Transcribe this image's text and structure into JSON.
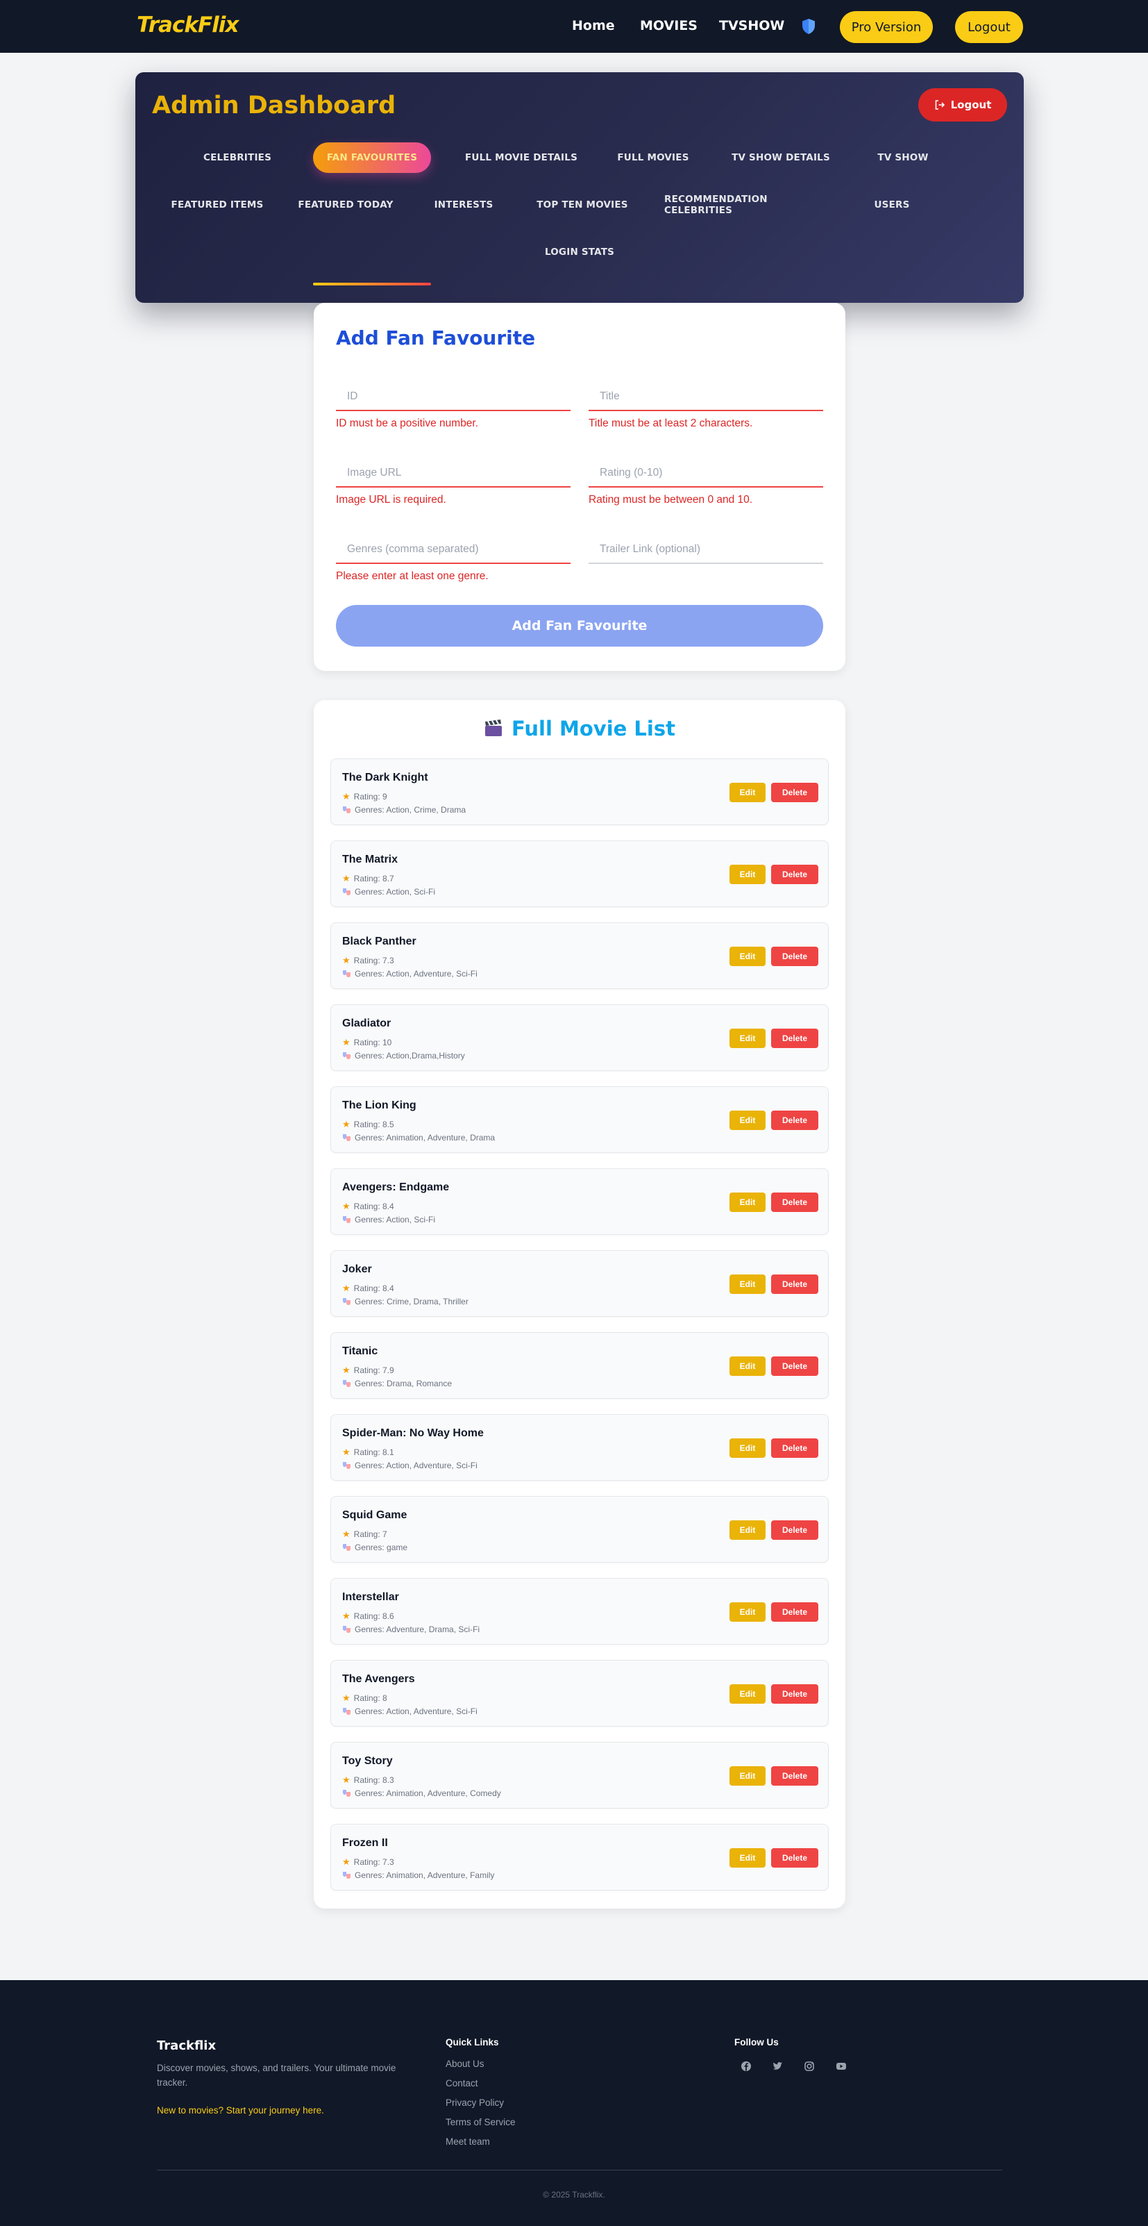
{
  "navbar": {
    "brand": "TrackFlix",
    "links": [
      "Home",
      "MOVIES",
      "TVSHOW"
    ],
    "shield_icon": "shield-icon",
    "pro_label": "Pro Version",
    "logout_label": "Logout",
    "accent": "#facc15"
  },
  "dashboard": {
    "title": "Admin Dashboard",
    "logout_label": "Logout",
    "tabs": [
      "CELEBRITIES",
      "FAN FAVOURITES",
      "FULL MOVIE DETAILS",
      "FULL MOVIES",
      "TV SHOW DETAILS",
      "TV SHOW",
      "FEATURED ITEMS",
      "FEATURED TODAY",
      "INTERESTS",
      "TOP TEN MOVIES",
      "RECOMMENDATION CELEBRITIES",
      "USERS",
      "LOGIN STATS"
    ],
    "active_tab": "FAN FAVOURITES"
  },
  "form": {
    "title": "Add Fan Favourite",
    "fields": [
      {
        "placeholder": "ID",
        "value": "",
        "error": "ID must be a positive number."
      },
      {
        "placeholder": "Title",
        "value": "",
        "error": "Title must be at least 2 characters."
      },
      {
        "placeholder": "Image URL",
        "value": "",
        "error": "Image URL is required."
      },
      {
        "placeholder": "Rating (0-10)",
        "value": "",
        "error": "Rating must be between 0 and 10."
      },
      {
        "placeholder": "Genres (comma separated)",
        "value": "",
        "error": "Please enter at least one genre."
      },
      {
        "placeholder": "Trailer Link (optional)",
        "value": "",
        "error": ""
      }
    ],
    "submit_label": "Add Fan Favourite"
  },
  "movie_list": {
    "title": "Full Movie List",
    "edit_label": "Edit",
    "delete_label": "Delete",
    "items": [
      {
        "title": "The Dark Knight",
        "rating": "Rating: 9",
        "genres": "Genres: Action, Crime, Drama"
      },
      {
        "title": "The Matrix",
        "rating": "Rating: 8.7",
        "genres": "Genres: Action, Sci-Fi"
      },
      {
        "title": "Black Panther",
        "rating": "Rating: 7.3",
        "genres": "Genres: Action, Adventure, Sci-Fi"
      },
      {
        "title": "Gladiator",
        "rating": "Rating: 10",
        "genres": "Genres: Action,Drama,History"
      },
      {
        "title": "The Lion King",
        "rating": "Rating: 8.5",
        "genres": "Genres: Animation, Adventure, Drama"
      },
      {
        "title": "Avengers: Endgame",
        "rating": "Rating: 8.4",
        "genres": "Genres: Action, Sci-Fi"
      },
      {
        "title": "Joker",
        "rating": "Rating: 8.4",
        "genres": "Genres: Crime, Drama, Thriller"
      },
      {
        "title": "Titanic",
        "rating": "Rating: 7.9",
        "genres": "Genres: Drama, Romance"
      },
      {
        "title": "Spider-Man: No Way Home",
        "rating": "Rating: 8.1",
        "genres": "Genres: Action, Adventure, Sci-Fi"
      },
      {
        "title": "Squid Game",
        "rating": "Rating: 7",
        "genres": "Genres: game"
      },
      {
        "title": "Interstellar",
        "rating": "Rating: 8.6",
        "genres": "Genres: Adventure, Drama, Sci-Fi"
      },
      {
        "title": "The Avengers",
        "rating": "Rating: 8",
        "genres": "Genres: Action, Adventure, Sci-Fi"
      },
      {
        "title": "Toy Story",
        "rating": "Rating: 8.3",
        "genres": "Genres: Animation, Adventure, Comedy"
      },
      {
        "title": "Frozen II",
        "rating": "Rating: 7.3",
        "genres": "Genres: Animation, Adventure, Family"
      }
    ]
  },
  "footer": {
    "brand": "Trackflix",
    "description": "Discover movies, shows, and trailers. Your ultimate movie tracker.",
    "cta": "New to movies? Start your journey here.",
    "quick_links_title": "Quick Links",
    "quick_links": [
      "About Us",
      "Contact",
      "Privacy Policy",
      "Terms of Service",
      "Meet team"
    ],
    "follow_title": "Follow Us",
    "social_icons": [
      "facebook-icon",
      "twitter-icon",
      "instagram-icon",
      "youtube-icon"
    ],
    "copyright": "© 2025 Trackflix."
  }
}
